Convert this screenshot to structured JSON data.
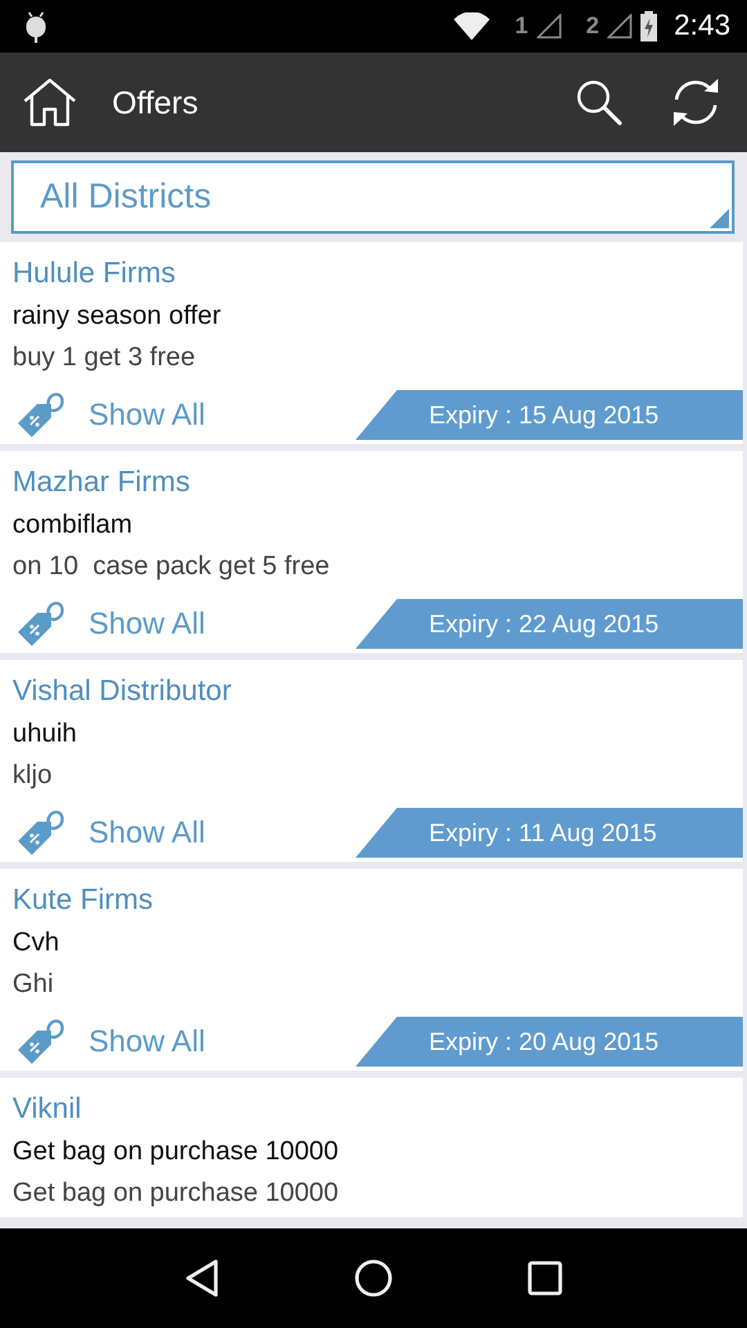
{
  "status_bar": {
    "sim_1": "1",
    "sim_2": "2",
    "time": "2:43"
  },
  "app_bar": {
    "title": "Offers"
  },
  "district_dropdown": {
    "value": "All Districts"
  },
  "offers": [
    {
      "company": "Hulule Firms",
      "title": "rainy season offer",
      "detail": "buy 1 get 3 free",
      "link": "Show All",
      "expiry": "Expiry : 15 Aug 2015"
    },
    {
      "company": "Mazhar Firms",
      "title": "combiflam",
      "detail": "on 10  case pack get 5 free",
      "link": "Show All",
      "expiry": "Expiry : 22 Aug 2015"
    },
    {
      "company": "Vishal Distributor",
      "title": "uhuih",
      "detail": "kljo",
      "link": "Show All",
      "expiry": "Expiry : 11 Aug 2015"
    },
    {
      "company": "Kute Firms",
      "title": "Cvh",
      "detail": "Ghi",
      "link": "Show All",
      "expiry": "Expiry : 20 Aug 2015"
    },
    {
      "company": "Viknil",
      "title": "Get bag on purchase 10000",
      "detail": "Get bag on purchase 10000"
    }
  ]
}
